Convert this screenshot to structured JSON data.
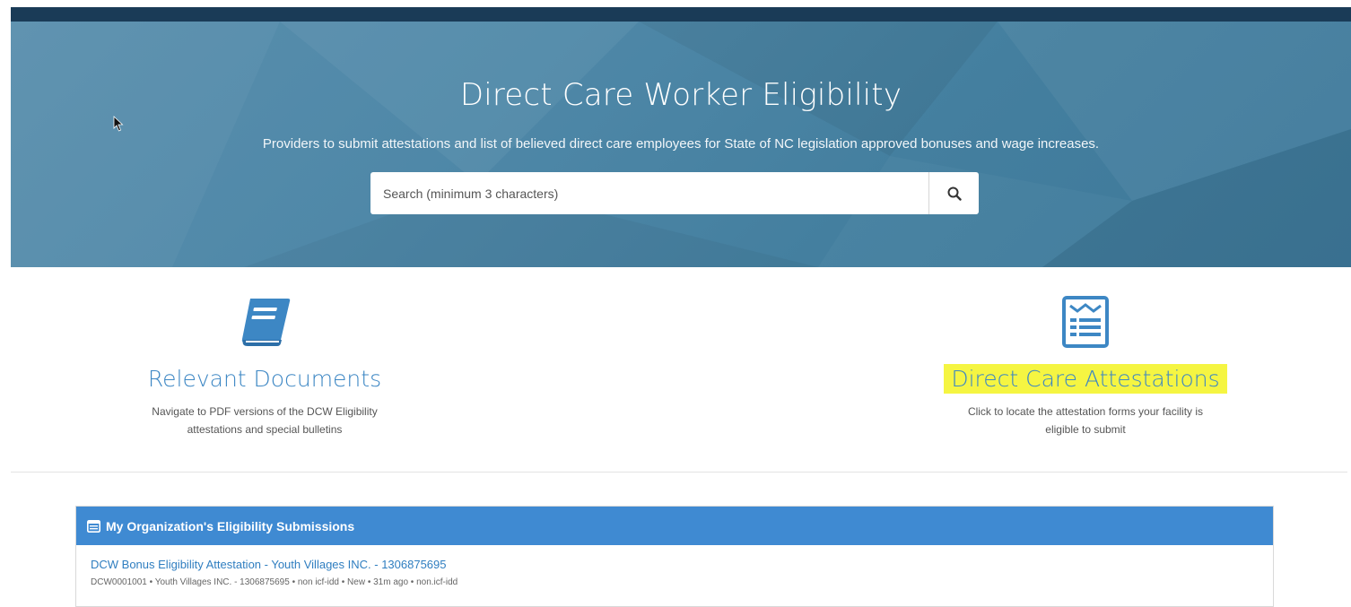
{
  "hero": {
    "title": "Direct Care Worker Eligibility",
    "subtitle": "Providers to submit attestations and list of believed direct care employees for State of NC legislation approved bonuses and wage increases.",
    "search_placeholder": "Search (minimum 3 characters)",
    "search_icon": "search-icon"
  },
  "tiles": [
    {
      "icon": "book-icon",
      "title": "Relevant Documents",
      "description_line1": "Navigate to PDF versions of the DCW Eligibility",
      "description_line2": "attestations and special bulletins"
    },
    {
      "icon": "form-icon",
      "title": "Direct Care Attestations",
      "description_line1": "Click to locate the attestation forms your facility is",
      "description_line2": "eligible to submit",
      "highlight_color": "#f5f542"
    }
  ],
  "submissions": {
    "header": "My Organization's Eligibility Submissions",
    "header_icon": "list-icon",
    "items": [
      {
        "title": "DCW Bonus Eligibility Attestation - Youth Villages INC. - 1306875695",
        "meta": "DCW0001001 • Youth Villages INC. - 1306875695 • non icf-idd • New • 31m ago • non.icf-idd"
      }
    ]
  },
  "colors": {
    "top_bar": "#1a3b57",
    "hero": "#4f88a8",
    "accent": "#3d87c4",
    "panel_header": "#3f8ad2"
  }
}
